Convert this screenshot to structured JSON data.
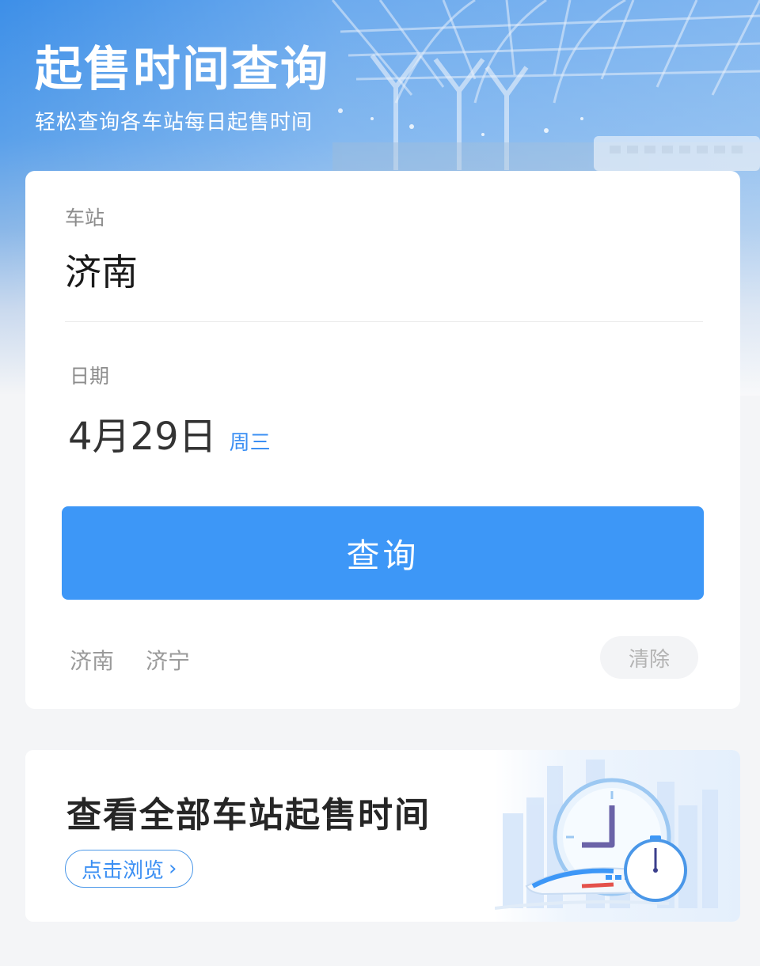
{
  "header": {
    "title": "起售时间查询",
    "subtitle": "轻松查询各车站每日起售时间"
  },
  "query_form": {
    "station": {
      "label": "车站",
      "value": "济南"
    },
    "date": {
      "label": "日期",
      "value": "4月29日",
      "weekday": "周三"
    },
    "query_button": "查询"
  },
  "history": {
    "items": [
      "济南",
      "济宁"
    ],
    "clear_button": "清除"
  },
  "banner": {
    "title": "查看全部车站起售时间",
    "link": "点击浏览"
  },
  "colors": {
    "primary_blue": "#3d97f7",
    "accent_text_blue": "#3b8ff3",
    "page_background": "#f4f5f7"
  },
  "icons": [
    "clock-icon",
    "stopwatch-icon",
    "train-icon",
    "chevron-right-icon"
  ]
}
